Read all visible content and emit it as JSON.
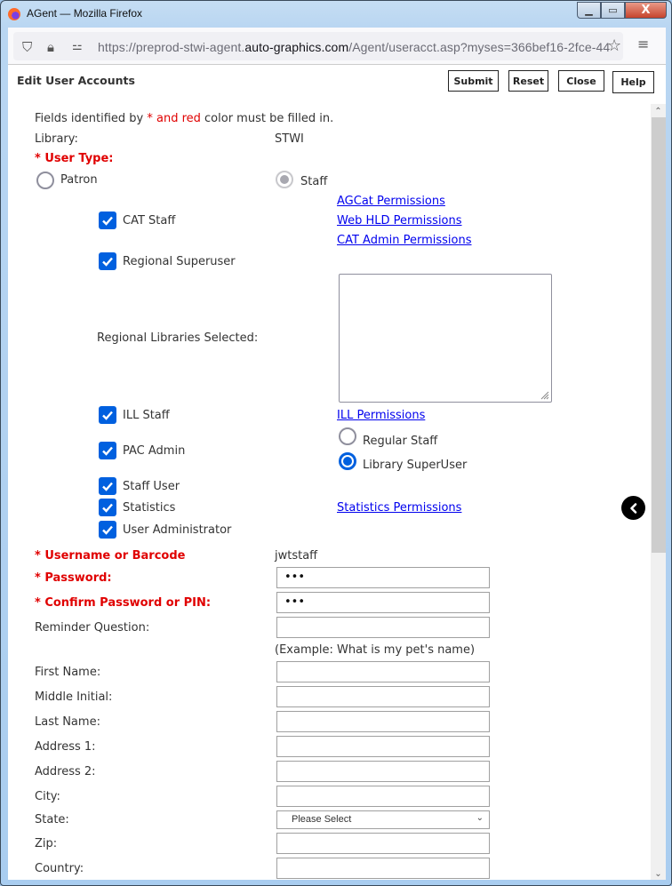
{
  "window": {
    "title": "AGent — Mozilla Firefox",
    "minimize_icon": "minimize-icon",
    "maximize_icon": "maximize-icon",
    "close_icon": "close-icon"
  },
  "browser": {
    "url_prefix": "https://preprod-stwi-agent.",
    "url_host": "auto-graphics.com",
    "url_path": "/Agent/useracct.asp?myses=366bef16-2fce-44",
    "icons": [
      "shield-icon",
      "lock-icon",
      "permissions-icon",
      "star-icon",
      "menu-icon"
    ]
  },
  "page": {
    "title": "Edit User Accounts",
    "buttons": {
      "submit": "Submit",
      "reset": "Reset",
      "close": "Close",
      "help": "Help"
    },
    "notice": {
      "prefix": "Fields identified by ",
      "highlight": "* and red",
      "suffix": " color must be filled in."
    },
    "library_label": "Library:",
    "library_value": "STWI",
    "user_type_label": "* User Type:",
    "user_type_options": [
      {
        "label": "Patron",
        "checked": false
      },
      {
        "label": "Staff",
        "checked": true,
        "disabled": true
      }
    ],
    "permissions_links": {
      "agcat": "AGCat Permissions",
      "web_hld": "Web HLD Permissions",
      "cat_admin": "CAT Admin Permissions",
      "ill": "ILL Permissions",
      "statistics": "Statistics Permissions"
    },
    "checkboxes": {
      "cat_staff": {
        "label": "CAT Staff",
        "checked": true
      },
      "regional_superuser": {
        "label": "Regional Superuser",
        "checked": true
      },
      "ill_staff": {
        "label": "ILL Staff",
        "checked": true
      },
      "pac_admin": {
        "label": "PAC Admin",
        "checked": true
      },
      "staff_user": {
        "label": "Staff User",
        "checked": true
      },
      "statistics": {
        "label": "Statistics",
        "checked": true
      },
      "user_administrator": {
        "label": "User Administrator",
        "checked": true
      }
    },
    "regional_libraries_label": "Regional Libraries Selected:",
    "regional_libraries_value": "",
    "pac_admin_options": [
      {
        "label": "Regular Staff",
        "checked": false
      },
      {
        "label": "Library SuperUser",
        "checked": true
      }
    ],
    "fields": {
      "username": {
        "label": "* Username or Barcode",
        "value": "jwtstaff"
      },
      "password": {
        "label": "* Password:",
        "value": "•••"
      },
      "confirm_password": {
        "label": "* Confirm Password or PIN:",
        "value": "•••"
      },
      "reminder_question": {
        "label": "Reminder Question:",
        "value": "",
        "hint": "(Example: What is my pet's name)"
      },
      "first_name": {
        "label": "First Name:",
        "value": ""
      },
      "middle_initial": {
        "label": "Middle Initial:",
        "value": ""
      },
      "last_name": {
        "label": "Last Name:",
        "value": ""
      },
      "address1": {
        "label": "Address 1:",
        "value": ""
      },
      "address2": {
        "label": "Address 2:",
        "value": ""
      },
      "city": {
        "label": "City:",
        "value": ""
      },
      "state": {
        "label": "State:",
        "value": "Please Select"
      },
      "zip": {
        "label": "Zip:",
        "value": ""
      },
      "country": {
        "label": "Country:",
        "value": ""
      }
    }
  },
  "colors": {
    "required": "#e00000",
    "link": "#0000ee",
    "checkbox": "#0060df"
  }
}
